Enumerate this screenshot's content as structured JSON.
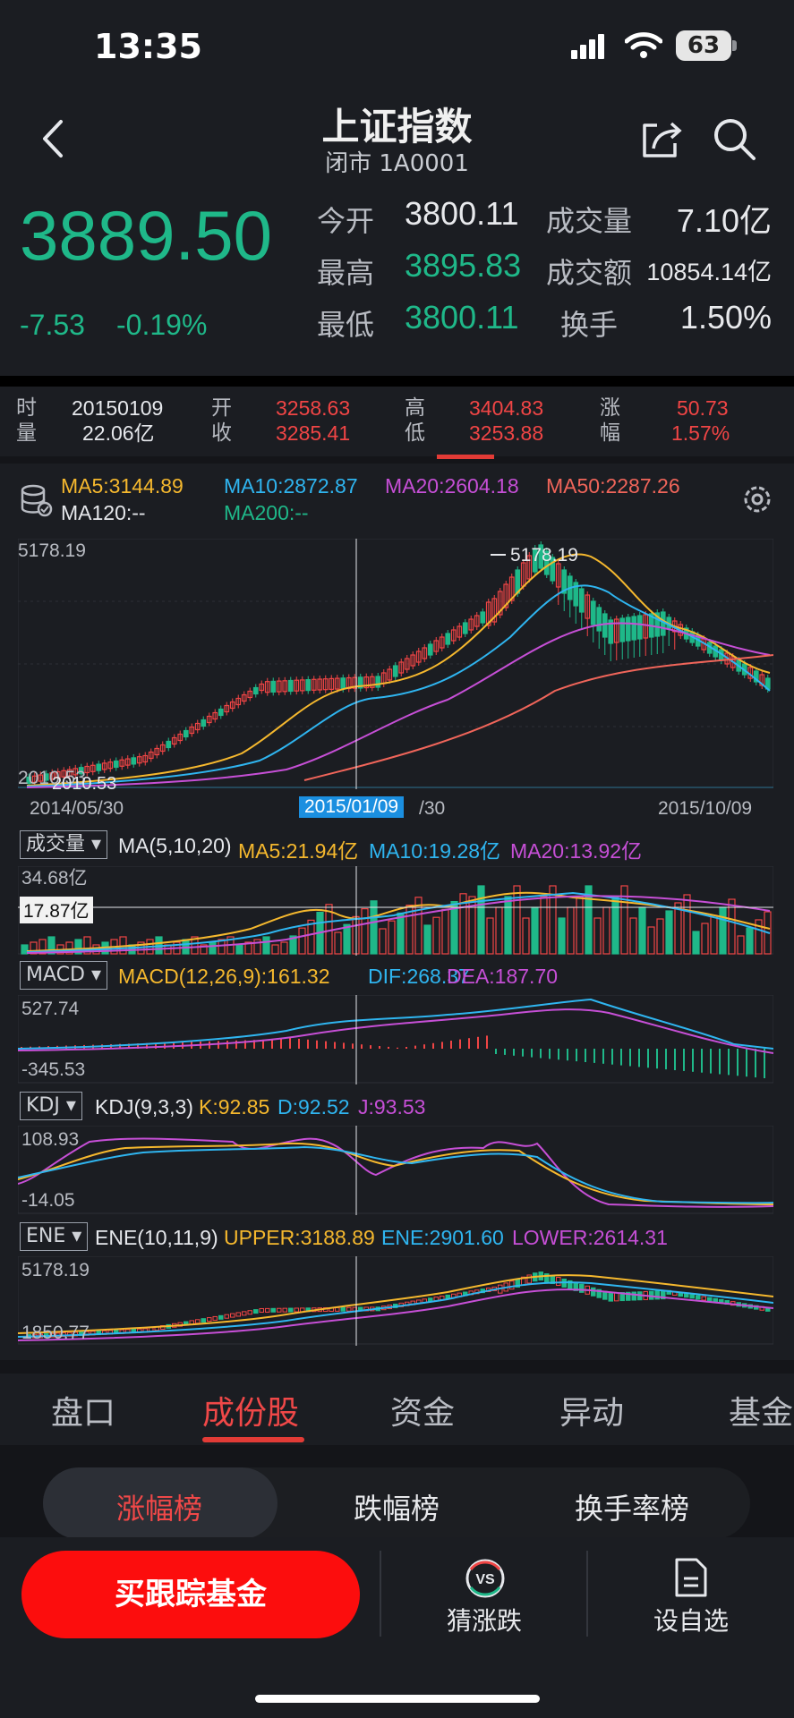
{
  "status": {
    "time": "13:35",
    "battery": "63"
  },
  "header": {
    "title": "上证指数",
    "subtitle": "闭市 1A0001"
  },
  "quote": {
    "price": "3889.50",
    "change": "-7.53",
    "change_pct": "-0.19%",
    "open_label": "今开",
    "open": "3800.11",
    "high_label": "最高",
    "high": "3895.83",
    "low_label": "最低",
    "low": "3800.11",
    "vol_label": "成交量",
    "vol": "7.10亿",
    "amt_label": "成交额",
    "amt": "10854.14亿",
    "turnover_label": "换手",
    "turnover": "1.50%"
  },
  "info": {
    "time_label": "时",
    "vol_label": "量",
    "date": "20150109",
    "volume": "22.06亿",
    "open_label": "开",
    "close_label": "收",
    "open": "3258.63",
    "close": "3285.41",
    "high_label": "高",
    "low_label": "低",
    "high": "3404.83",
    "low": "3253.88",
    "chg_label": "涨",
    "pct_label": "幅",
    "chg": "50.73",
    "pct": "1.57%"
  },
  "ma": {
    "ma5": "MA5:3144.89",
    "ma10": "MA10:2872.87",
    "ma20": "MA20:2604.18",
    "ma50": "MA50:2287.26",
    "ma120": "MA120:--",
    "ma200": "MA200:--"
  },
  "kline": {
    "ymax": "5178.19",
    "ymin": "2010.53",
    "max_marker": "5178.19",
    "min_marker": "2010.53",
    "date_start": "2014/05/30",
    "date_cursor": "2015/01/09",
    "date_mid": "/30",
    "date_end": "2015/10/09"
  },
  "volume_panel": {
    "selector": "成交量",
    "params": "MA(5,10,20)",
    "ma5": "MA5:21.94亿",
    "ma10": "MA10:19.28亿",
    "ma20": "MA20:13.92亿",
    "ymax": "34.68亿",
    "cursor_value": "17.87亿"
  },
  "macd_panel": {
    "selector": "MACD",
    "params": "MACD(12,26,9):161.32",
    "dif": "DIF:268.37",
    "dea": "DEA:187.70",
    "ymax": "527.74",
    "ymin": "-345.53"
  },
  "kdj_panel": {
    "selector": "KDJ",
    "params": "KDJ(9,3,3)",
    "k": "K:92.85",
    "d": "D:92.52",
    "j": "J:93.53",
    "ymax": "108.93",
    "ymin": "-14.05"
  },
  "ene_panel": {
    "selector": "ENE",
    "params": "ENE(10,11,9)",
    "upper": "UPPER:3188.89",
    "ene": "ENE:2901.60",
    "lower": "LOWER:2614.31",
    "ymax": "5178.19",
    "ymin": "1850.77"
  },
  "tabs": [
    "盘口",
    "成份股",
    "资金",
    "异动",
    "基金"
  ],
  "subtabs": [
    "涨幅榜",
    "跌幅榜",
    "换手率榜"
  ],
  "bottom": {
    "buy": "买跟踪基金",
    "guess": "猜涨跌",
    "watch": "设自选",
    "vs": "VS"
  },
  "colors": {
    "up": "#f04545",
    "down": "#1fb889",
    "ma5": "#f5b82e",
    "ma10": "#2fb5f0",
    "ma20": "#c64fd6",
    "ma50": "#f0655a",
    "ma200": "#1fb889"
  }
}
